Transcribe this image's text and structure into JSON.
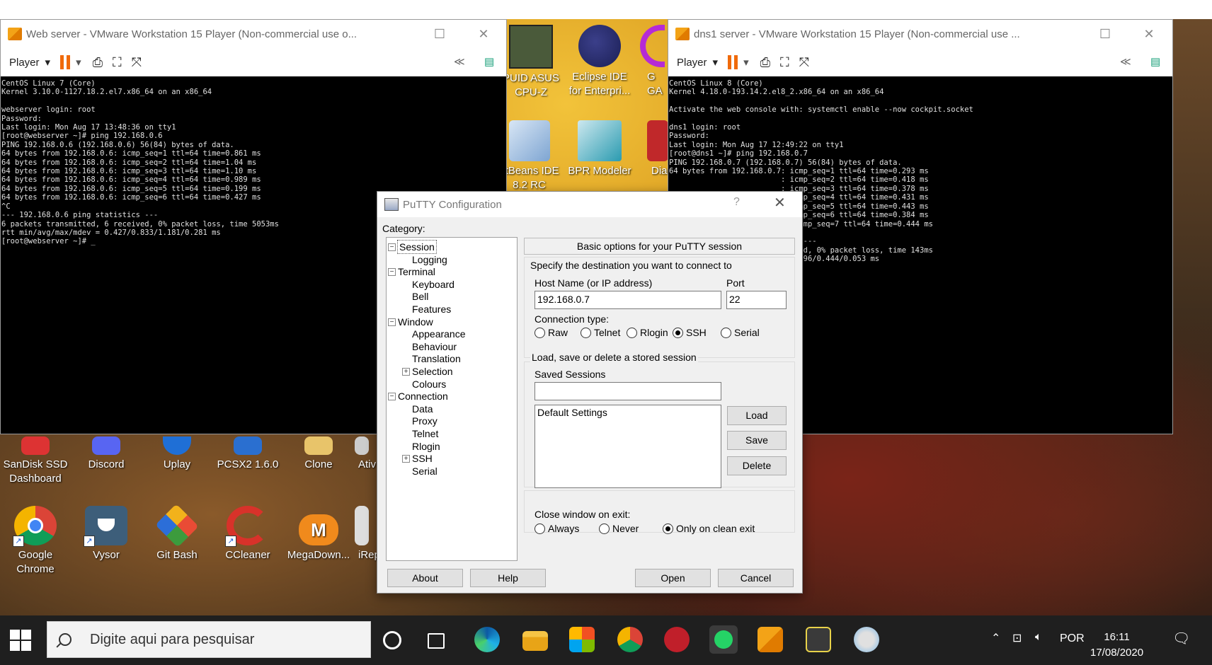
{
  "desktop": {
    "top_icons": [
      {
        "label": "PUID ASUS\nCPU-Z"
      },
      {
        "label": "Eclipse IDE\nfor Enterpri..."
      },
      {
        "label": "G\nGA"
      },
      {
        "label": "etBeans IDE\n8.2 RC"
      },
      {
        "label": "BPR Modeler"
      },
      {
        "label": "Dia"
      }
    ],
    "icons_row1": [
      {
        "label": "SanDisk SSD\nDashboard"
      },
      {
        "label": "Discord"
      },
      {
        "label": "Uplay"
      },
      {
        "label": "PCSX2 1.6.0"
      },
      {
        "label": "Clone"
      },
      {
        "label": "Ativ"
      }
    ],
    "icons_row2": [
      {
        "label": "Google\nChrome"
      },
      {
        "label": "Vysor"
      },
      {
        "label": "Git Bash"
      },
      {
        "label": "CCleaner"
      },
      {
        "label": "MegaDown..."
      },
      {
        "label": "iRep"
      }
    ]
  },
  "vm_left": {
    "title": "Web server - VMware Workstation 15 Player (Non-commercial use o...",
    "player_label": "Player",
    "console": "CentOS Linux 7 (Core)\nKernel 3.10.0-1127.18.2.el7.x86_64 on an x86_64\n\nwebserver login: root\nPassword:\nLast login: Mon Aug 17 13:48:36 on tty1\n[root@webserver ~]# ping 192.168.0.6\nPING 192.168.0.6 (192.168.0.6) 56(84) bytes of data.\n64 bytes from 192.168.0.6: icmp_seq=1 ttl=64 time=0.861 ms\n64 bytes from 192.168.0.6: icmp_seq=2 ttl=64 time=1.04 ms\n64 bytes from 192.168.0.6: icmp_seq=3 ttl=64 time=1.10 ms\n64 bytes from 192.168.0.6: icmp_seq=4 ttl=64 time=0.989 ms\n64 bytes from 192.168.0.6: icmp_seq=5 ttl=64 time=0.199 ms\n64 bytes from 192.168.0.6: icmp_seq=6 ttl=64 time=0.427 ms\n^C\n--- 192.168.0.6 ping statistics ---\n6 packets transmitted, 6 received, 0% packet loss, time 5053ms\nrtt min/avg/max/mdev = 0.427/0.833/1.181/0.281 ms\n[root@webserver ~]# _"
  },
  "vm_right": {
    "title": "dns1 server - VMware Workstation 15 Player (Non-commercial use ...",
    "player_label": "Player",
    "console": "CentOS Linux 8 (Core)\nKernel 4.18.0-193.14.2.el8_2.x86_64 on an x86_64\n\nActivate the web console with: systemctl enable --now cockpit.socket\n\ndns1 login: root\nPassword:\nLast login: Mon Aug 17 12:49:22 on tty1\n[root@dns1 ~]# ping 192.168.0.7\nPING 192.168.0.7 (192.168.0.7) 56(84) bytes of data.\n64 bytes from 192.168.0.7: icmp_seq=1 ttl=64 time=0.293 ms\n                         : icmp_seq=2 ttl=64 time=0.418 ms\n                         : icmp_seq=3 ttl=64 time=0.378 ms\n                         : icmp_seq=4 ttl=64 time=0.431 ms\n                         : icmp_seq=5 ttl=64 time=0.443 ms\n                         : icmp_seq=6 ttl=64 time=0.384 ms\n                         7: icmp_seq=7 ttl=64 time=0.444 ms\n\n                         tics ---\n                         ceived, 0% packet loss, time 143ms\n                         3/0.396/0.444/0.053 ms"
  },
  "putty": {
    "title": "PuTTY Configuration",
    "help_glyph": "?",
    "category_label": "Category:",
    "tree": [
      {
        "label": "Session",
        "level": 0,
        "expander": "−",
        "selected": true
      },
      {
        "label": "Logging",
        "level": 1
      },
      {
        "label": "Terminal",
        "level": 0,
        "expander": "−"
      },
      {
        "label": "Keyboard",
        "level": 1
      },
      {
        "label": "Bell",
        "level": 1
      },
      {
        "label": "Features",
        "level": 1
      },
      {
        "label": "Window",
        "level": 0,
        "expander": "−"
      },
      {
        "label": "Appearance",
        "level": 1
      },
      {
        "label": "Behaviour",
        "level": 1
      },
      {
        "label": "Translation",
        "level": 1
      },
      {
        "label": "Selection",
        "level": 1,
        "expander": "+"
      },
      {
        "label": "Colours",
        "level": 1
      },
      {
        "label": "Connection",
        "level": 0,
        "expander": "−"
      },
      {
        "label": "Data",
        "level": 1
      },
      {
        "label": "Proxy",
        "level": 1
      },
      {
        "label": "Telnet",
        "level": 1
      },
      {
        "label": "Rlogin",
        "level": 1
      },
      {
        "label": "SSH",
        "level": 1,
        "expander": "+"
      },
      {
        "label": "Serial",
        "level": 1
      }
    ],
    "header": "Basic options for your PuTTY session",
    "specify_label": "Specify the destination you want to connect to",
    "host_label": "Host Name (or IP address)",
    "host_value": "192.168.0.7",
    "port_label": "Port",
    "port_value": "22",
    "conn_type_label": "Connection type:",
    "conn_types": [
      {
        "label": "Raw",
        "checked": false
      },
      {
        "label": "Telnet",
        "checked": false
      },
      {
        "label": "Rlogin",
        "checked": false
      },
      {
        "label": "SSH",
        "checked": true
      },
      {
        "label": "Serial",
        "checked": false
      }
    ],
    "sessions_group_label": "Load, save or delete a stored session",
    "saved_sessions_label": "Saved Sessions",
    "saved_sessions_value": "",
    "session_list": [
      "Default Settings"
    ],
    "load_label": "Load",
    "save_label": "Save",
    "delete_label": "Delete",
    "close_on_exit_label": "Close window on exit:",
    "close_options": [
      {
        "label": "Always",
        "checked": false
      },
      {
        "label": "Never",
        "checked": false
      },
      {
        "label": "Only on clean exit",
        "checked": true
      }
    ],
    "about_label": "About",
    "help_label": "Help",
    "open_label": "Open",
    "cancel_label": "Cancel"
  },
  "taskbar": {
    "search_placeholder": "Digite aqui para pesquisar",
    "language": "POR",
    "time": "16:11",
    "date": "17/08/2020"
  }
}
